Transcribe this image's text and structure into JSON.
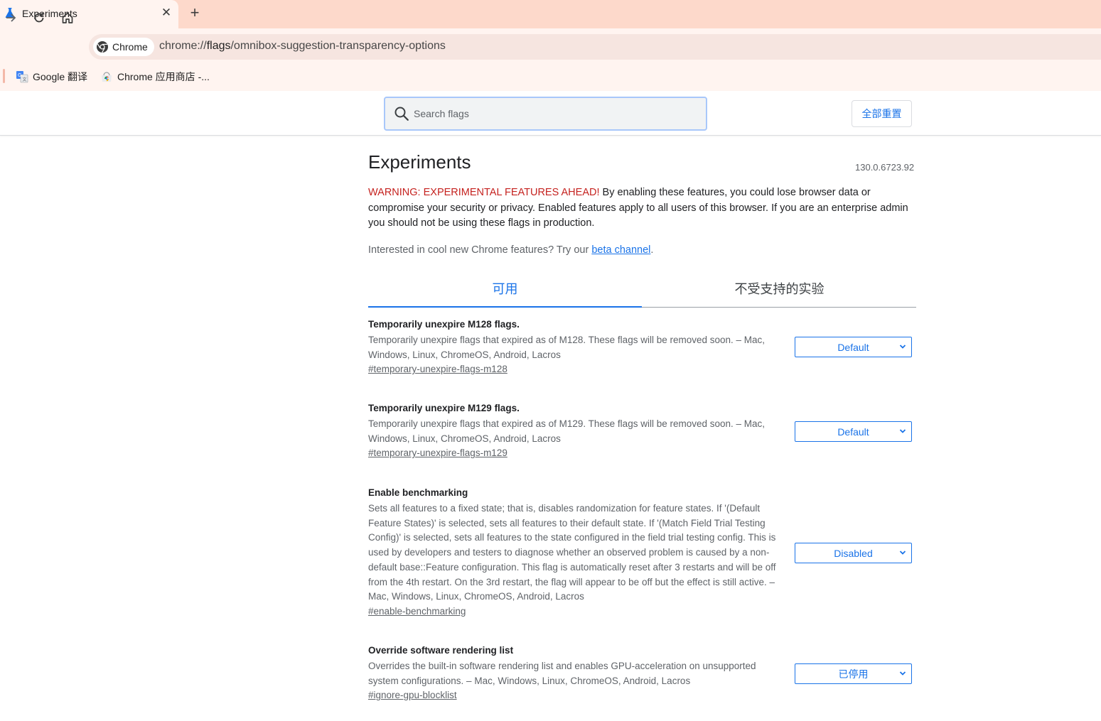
{
  "browser": {
    "tab_title": "Experiments",
    "tab_close_glyph": "✕",
    "new_tab_glyph": "+",
    "chip_label": "Chrome",
    "url_scheme": "chrome://",
    "url_host": "flags",
    "url_path": "/omnibox-suggestion-transparency-options",
    "bookmarks": [
      {
        "label": "Google 翻译",
        "icon": "google-translate-icon"
      },
      {
        "label": "Chrome 应用商店 -...",
        "icon": "chrome-web-store-icon"
      }
    ]
  },
  "header": {
    "search_placeholder": "Search flags",
    "reset_label": "全部重置"
  },
  "main": {
    "title": "Experiments",
    "version": "130.0.6723.92",
    "warning_prefix": "WARNING: EXPERIMENTAL FEATURES AHEAD!",
    "warning_text": " By enabling these features, you could lose browser data or compromise your security or privacy. Enabled features apply to all users of this browser. If you are an enterprise admin you should not be using these flags in production.",
    "interest_text": "Interested in cool new Chrome features? Try our ",
    "beta_link": "beta channel",
    "interest_suffix": ".",
    "tabs": [
      {
        "label": "可用",
        "active": true
      },
      {
        "label": "不受支持的实验",
        "active": false
      }
    ]
  },
  "flags": [
    {
      "name": "Temporarily unexpire M128 flags.",
      "description": "Temporarily unexpire flags that expired as of M128. These flags will be removed soon. – Mac, Windows, Linux, ChromeOS, Android, Lacros",
      "link": "#temporary-unexpire-flags-m128",
      "value": "Default"
    },
    {
      "name": "Temporarily unexpire M129 flags.",
      "description": "Temporarily unexpire flags that expired as of M129. These flags will be removed soon. – Mac, Windows, Linux, ChromeOS, Android, Lacros",
      "link": "#temporary-unexpire-flags-m129",
      "value": "Default"
    },
    {
      "name": "Enable benchmarking",
      "description": "Sets all features to a fixed state; that is, disables randomization for feature states. If '(Default Feature States)' is selected, sets all features to their default state. If '(Match Field Trial Testing Config)' is selected, sets all features to the state configured in the field trial testing config. This is used by developers and testers to diagnose whether an observed problem is caused by a non-default base::Feature configuration. This flag is automatically reset after 3 restarts and will be off from the 4th restart. On the 3rd restart, the flag will appear to be off but the effect is still active. – Mac, Windows, Linux, ChromeOS, Android, Lacros",
      "link": "#enable-benchmarking",
      "value": "Disabled"
    },
    {
      "name": "Override software rendering list",
      "description": "Overrides the built-in software rendering list and enables GPU-acceleration on unsupported system configurations. – Mac, Windows, Linux, ChromeOS, Android, Lacros",
      "link": "#ignore-gpu-blocklist",
      "value": "已停用"
    }
  ],
  "colors": {
    "accent": "#1a73e8",
    "warning": "#c5221f",
    "tabstrip": "#fdd9cb",
    "toolbar": "#fff4f0"
  }
}
